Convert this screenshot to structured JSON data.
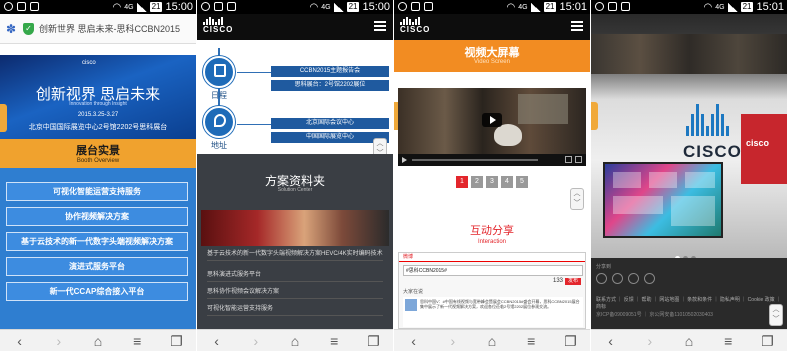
{
  "status_bar": {
    "phone1": {
      "network": "4G",
      "battery": "21",
      "time": "15:00"
    },
    "phone2": {
      "network": "4G",
      "battery": "21",
      "time": "15:00"
    },
    "phone3": {
      "network": "4G",
      "battery": "21",
      "time": "15:01"
    },
    "phone4": {
      "network": "4G",
      "battery": "21",
      "time": "15:01"
    }
  },
  "phone1": {
    "address_text": "创新世界 思启未来-思科CCBN2015",
    "banner": {
      "brand": "cisco",
      "title": "创新视界 思启未来",
      "subtitle": "Innovation through Insight",
      "date": "2015.3.25-3.27",
      "venue": "北京中国国际展览中心2号馆2202号思科展台"
    },
    "booth": {
      "title": "展台实景",
      "subtitle": "Booth Overview"
    },
    "services": [
      "可视化智能运营支持服务",
      "协作视频解决方案",
      "基于云技术的新一代数字头端视频解决方案",
      "演进式服务平台",
      "新一代CCAP综合接入平台"
    ]
  },
  "phone2": {
    "brand": "CISCO",
    "schedule": {
      "label": "日程",
      "lines": [
        "CCBN2015主题报告会",
        "思科展台：2号馆2202展位"
      ]
    },
    "address": {
      "label": "地址",
      "lines": [
        "北京国际会议中心",
        "中国国际展览中心"
      ]
    },
    "solution": {
      "title": "方案资料夹",
      "subtitle": "Solution Center",
      "items": [
        "基于云技术的新一代数字头端视频解决方案HEVC/4K实时编码技术",
        "思科演进式服务平台",
        "思科协作视频会议解决方案",
        "可视化智能运营支持服务"
      ]
    }
  },
  "phone3": {
    "brand": "CISCO",
    "video": {
      "title": "视频大屏幕",
      "subtitle": "Video Screen"
    },
    "pager": [
      "1",
      "2",
      "3",
      "4",
      "5"
    ],
    "share": {
      "title": "互动分享",
      "subtitle": "Interaction",
      "weibo_header": "微博",
      "input_text": "#思科CCBN2015#",
      "count": "133",
      "send": "发布",
      "tab": "大家在说",
      "post": "思科中国V：#中国有线视频与宽带峰会暨展会CCBN2015#盛会开幕，思科CCBN2015展台集中展示了新一代视频解决方案，欢迎各位莅临2号馆2202展位参观交流。"
    }
  },
  "phone4": {
    "wall_brand": "CISCO",
    "red_panel_brand": "cisco",
    "footer": {
      "share_label": "分享到",
      "links": "联系方式 ｜ 反馈 ｜ 帮助 ｜ 网站地图 ｜ 条款和条件 ｜ 隐私声明 ｜ Cookie 政策 ｜ 商标",
      "icp": "京ICP备09009051号 ｜ 京公网安备11010502030403"
    }
  },
  "colors": {
    "booth_orange": "#f0a22e",
    "service_blue": "#2f7ed0",
    "cisco_blue": "#1e6bb8",
    "accent_red": "#e3262c",
    "video_orange": "#f28c22"
  }
}
